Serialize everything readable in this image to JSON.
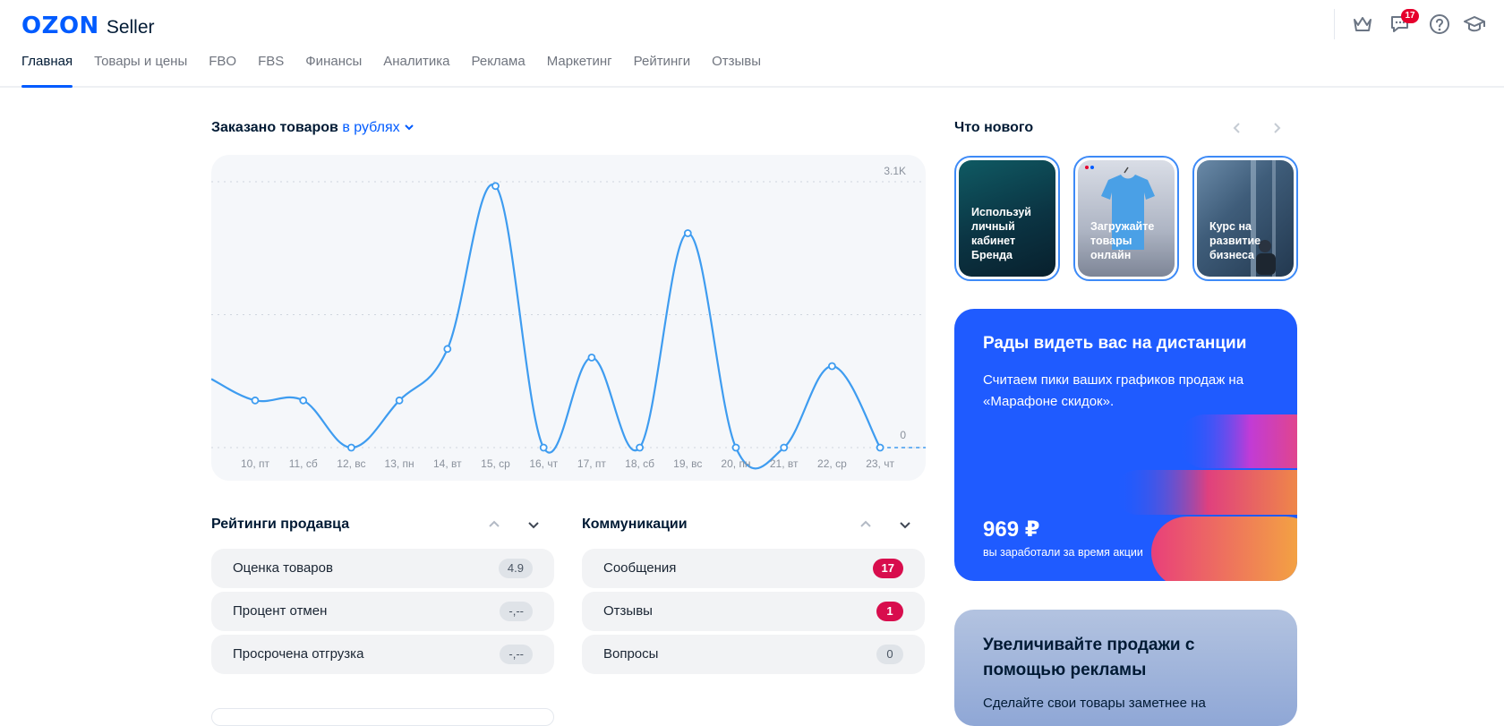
{
  "header": {
    "logo_brand": "OZON",
    "logo_product": "Seller",
    "icons": [
      "crown-icon",
      "chat-icon",
      "help-icon",
      "education-icon"
    ],
    "notifications_count": "17"
  },
  "nav": {
    "items": [
      {
        "label": "Главная",
        "active": true
      },
      {
        "label": "Товары и цены"
      },
      {
        "label": "FBO"
      },
      {
        "label": "FBS"
      },
      {
        "label": "Финансы"
      },
      {
        "label": "Аналитика"
      },
      {
        "label": "Реклама"
      },
      {
        "label": "Маркетинг"
      },
      {
        "label": "Рейтинги"
      },
      {
        "label": "Отзывы"
      }
    ]
  },
  "orders": {
    "title": "Заказано товаров",
    "unit_selector": "в рублях"
  },
  "chart_data": {
    "type": "line",
    "categories": [
      "10, пт",
      "11, сб",
      "12, вс",
      "13, пн",
      "14, вт",
      "15, ср",
      "16, чт",
      "17, пт",
      "18, сб",
      "19, вс",
      "20, пн",
      "21, вт",
      "22, ср",
      "23, чт"
    ],
    "series": [
      {
        "values": [
          550,
          550,
          0,
          550,
          1150,
          3050,
          0,
          1050,
          0,
          2500,
          0,
          0,
          950,
          0
        ]
      }
    ],
    "ytick_labels": [
      "3.1K",
      "0"
    ],
    "ylim": [
      0,
      3100
    ],
    "grid": true,
    "color": "#3e9cf0"
  },
  "ratings": {
    "title": "Рейтинги продавца",
    "rows": [
      {
        "label": "Оценка товаров",
        "value": "4.9"
      },
      {
        "label": "Процент отмен",
        "value": "-,--"
      },
      {
        "label": "Просрочена отгрузка",
        "value": "-,--"
      }
    ]
  },
  "communications": {
    "title": "Коммуникации",
    "rows": [
      {
        "label": "Сообщения",
        "value": "17"
      },
      {
        "label": "Отзывы",
        "value": "1"
      },
      {
        "label": "Вопросы",
        "value": "0"
      }
    ]
  },
  "news": {
    "title": "Что нового",
    "stories": [
      {
        "text": "Используй личный кабинет Бренда"
      },
      {
        "text": "Загружайте товары онлайн"
      },
      {
        "text": "Курс на развитие бизнеса"
      }
    ]
  },
  "promo_marathon": {
    "title": "Рады видеть вас на дистанции",
    "text": "Считаем пики ваших графиков продаж на «Марафоне скидок».",
    "amount": "969 ₽",
    "caption": "вы заработали за время акции"
  },
  "promo_ads": {
    "title": "Увеличивайте продажи с помощью рекламы",
    "text": "Сделайте свои товары заметнее на"
  },
  "colors": {
    "accent": "#005bff",
    "badge_red": "#d80d4d",
    "promo_blue": "#1f5bff"
  }
}
